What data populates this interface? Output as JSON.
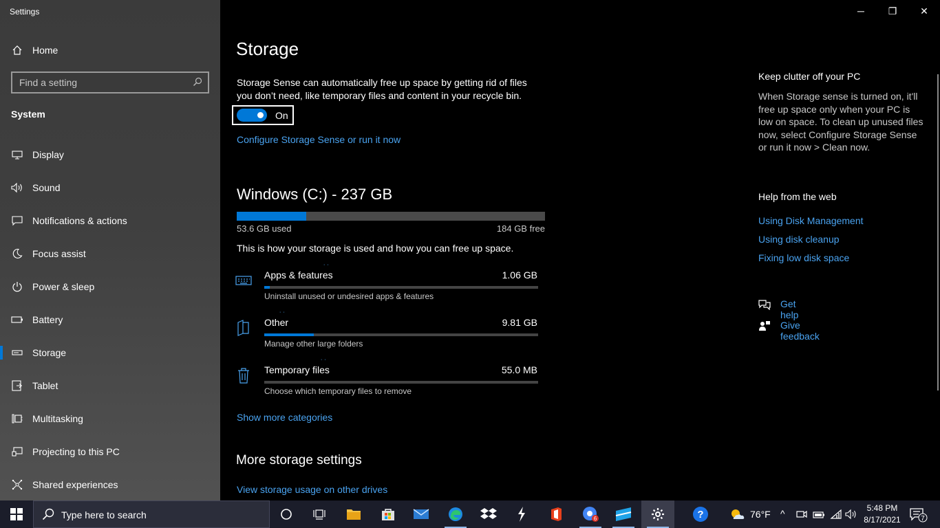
{
  "window": {
    "title": "Settings",
    "minimize_glyph": "─",
    "maximize_glyph": "❐",
    "close_glyph": "✕"
  },
  "sidebar": {
    "home_label": "Home",
    "search_placeholder": "Find a setting",
    "section_title": "System",
    "items": [
      {
        "label": "Display",
        "icon": "monitor-icon"
      },
      {
        "label": "Sound",
        "icon": "speaker-icon"
      },
      {
        "label": "Notifications & actions",
        "icon": "notification-icon"
      },
      {
        "label": "Focus assist",
        "icon": "moon-icon"
      },
      {
        "label": "Power & sleep",
        "icon": "power-icon"
      },
      {
        "label": "Battery",
        "icon": "battery-icon"
      },
      {
        "label": "Storage",
        "icon": "storage-icon",
        "selected": true
      },
      {
        "label": "Tablet",
        "icon": "tablet-icon"
      },
      {
        "label": "Multitasking",
        "icon": "multitasking-icon"
      },
      {
        "label": "Projecting to this PC",
        "icon": "projecting-icon"
      },
      {
        "label": "Shared experiences",
        "icon": "shared-experiences-icon"
      }
    ]
  },
  "main": {
    "title": "Storage",
    "sense_description": "Storage Sense can automatically free up space by getting rid of files you don’t need, like temporary files and content in your recycle bin.",
    "toggle_state": "On",
    "configure_link": "Configure Storage Sense or run it now",
    "drive": {
      "title": "Windows (C:) - 237 GB",
      "used": "53.6 GB used",
      "free": "184 GB free",
      "used_fraction": 0.226
    },
    "usage_description": "This is how your storage is used and how you can free up space.",
    "categories": [
      {
        "name": "Apps & features",
        "size": "1.06 GB",
        "sub": "Uninstall unused or undesired apps & features",
        "fraction": 0.02,
        "icon": "keyboard-icon"
      },
      {
        "name": "Other",
        "size": "9.81 GB",
        "sub": "Manage other large folders",
        "fraction": 0.18,
        "icon": "folder-icon"
      },
      {
        "name": "Temporary files",
        "size": "55.0 MB",
        "sub": "Choose which temporary files to remove",
        "fraction": 0.0,
        "icon": "trash-icon"
      }
    ],
    "show_more": "Show more categories",
    "more_title": "More storage settings",
    "view_usage": "View storage usage on other drives"
  },
  "right": {
    "clutter_title": "Keep clutter off your PC",
    "clutter_desc": "When Storage sense is turned on, it'll free up space only when your PC is low on space. To clean up unused files now, select Configure Storage Sense or run it now > Clean now.",
    "web_title": "Help from the web",
    "web_links": [
      "Using Disk Management",
      "Using disk cleanup",
      "Fixing low disk space"
    ],
    "get_help": "Get help",
    "give_feedback": "Give feedback"
  },
  "taskbar": {
    "search_placeholder": "Type here to search",
    "weather": "76°F",
    "time": "5:48 PM",
    "date": "8/17/2021",
    "notification_count": "7",
    "chrome_badge": "6"
  },
  "colors": {
    "accent": "#0078d7",
    "link": "#4aa3f0",
    "sidebar_bg": "#3f3f3f",
    "taskbar_bg": "#1b1d2a"
  }
}
